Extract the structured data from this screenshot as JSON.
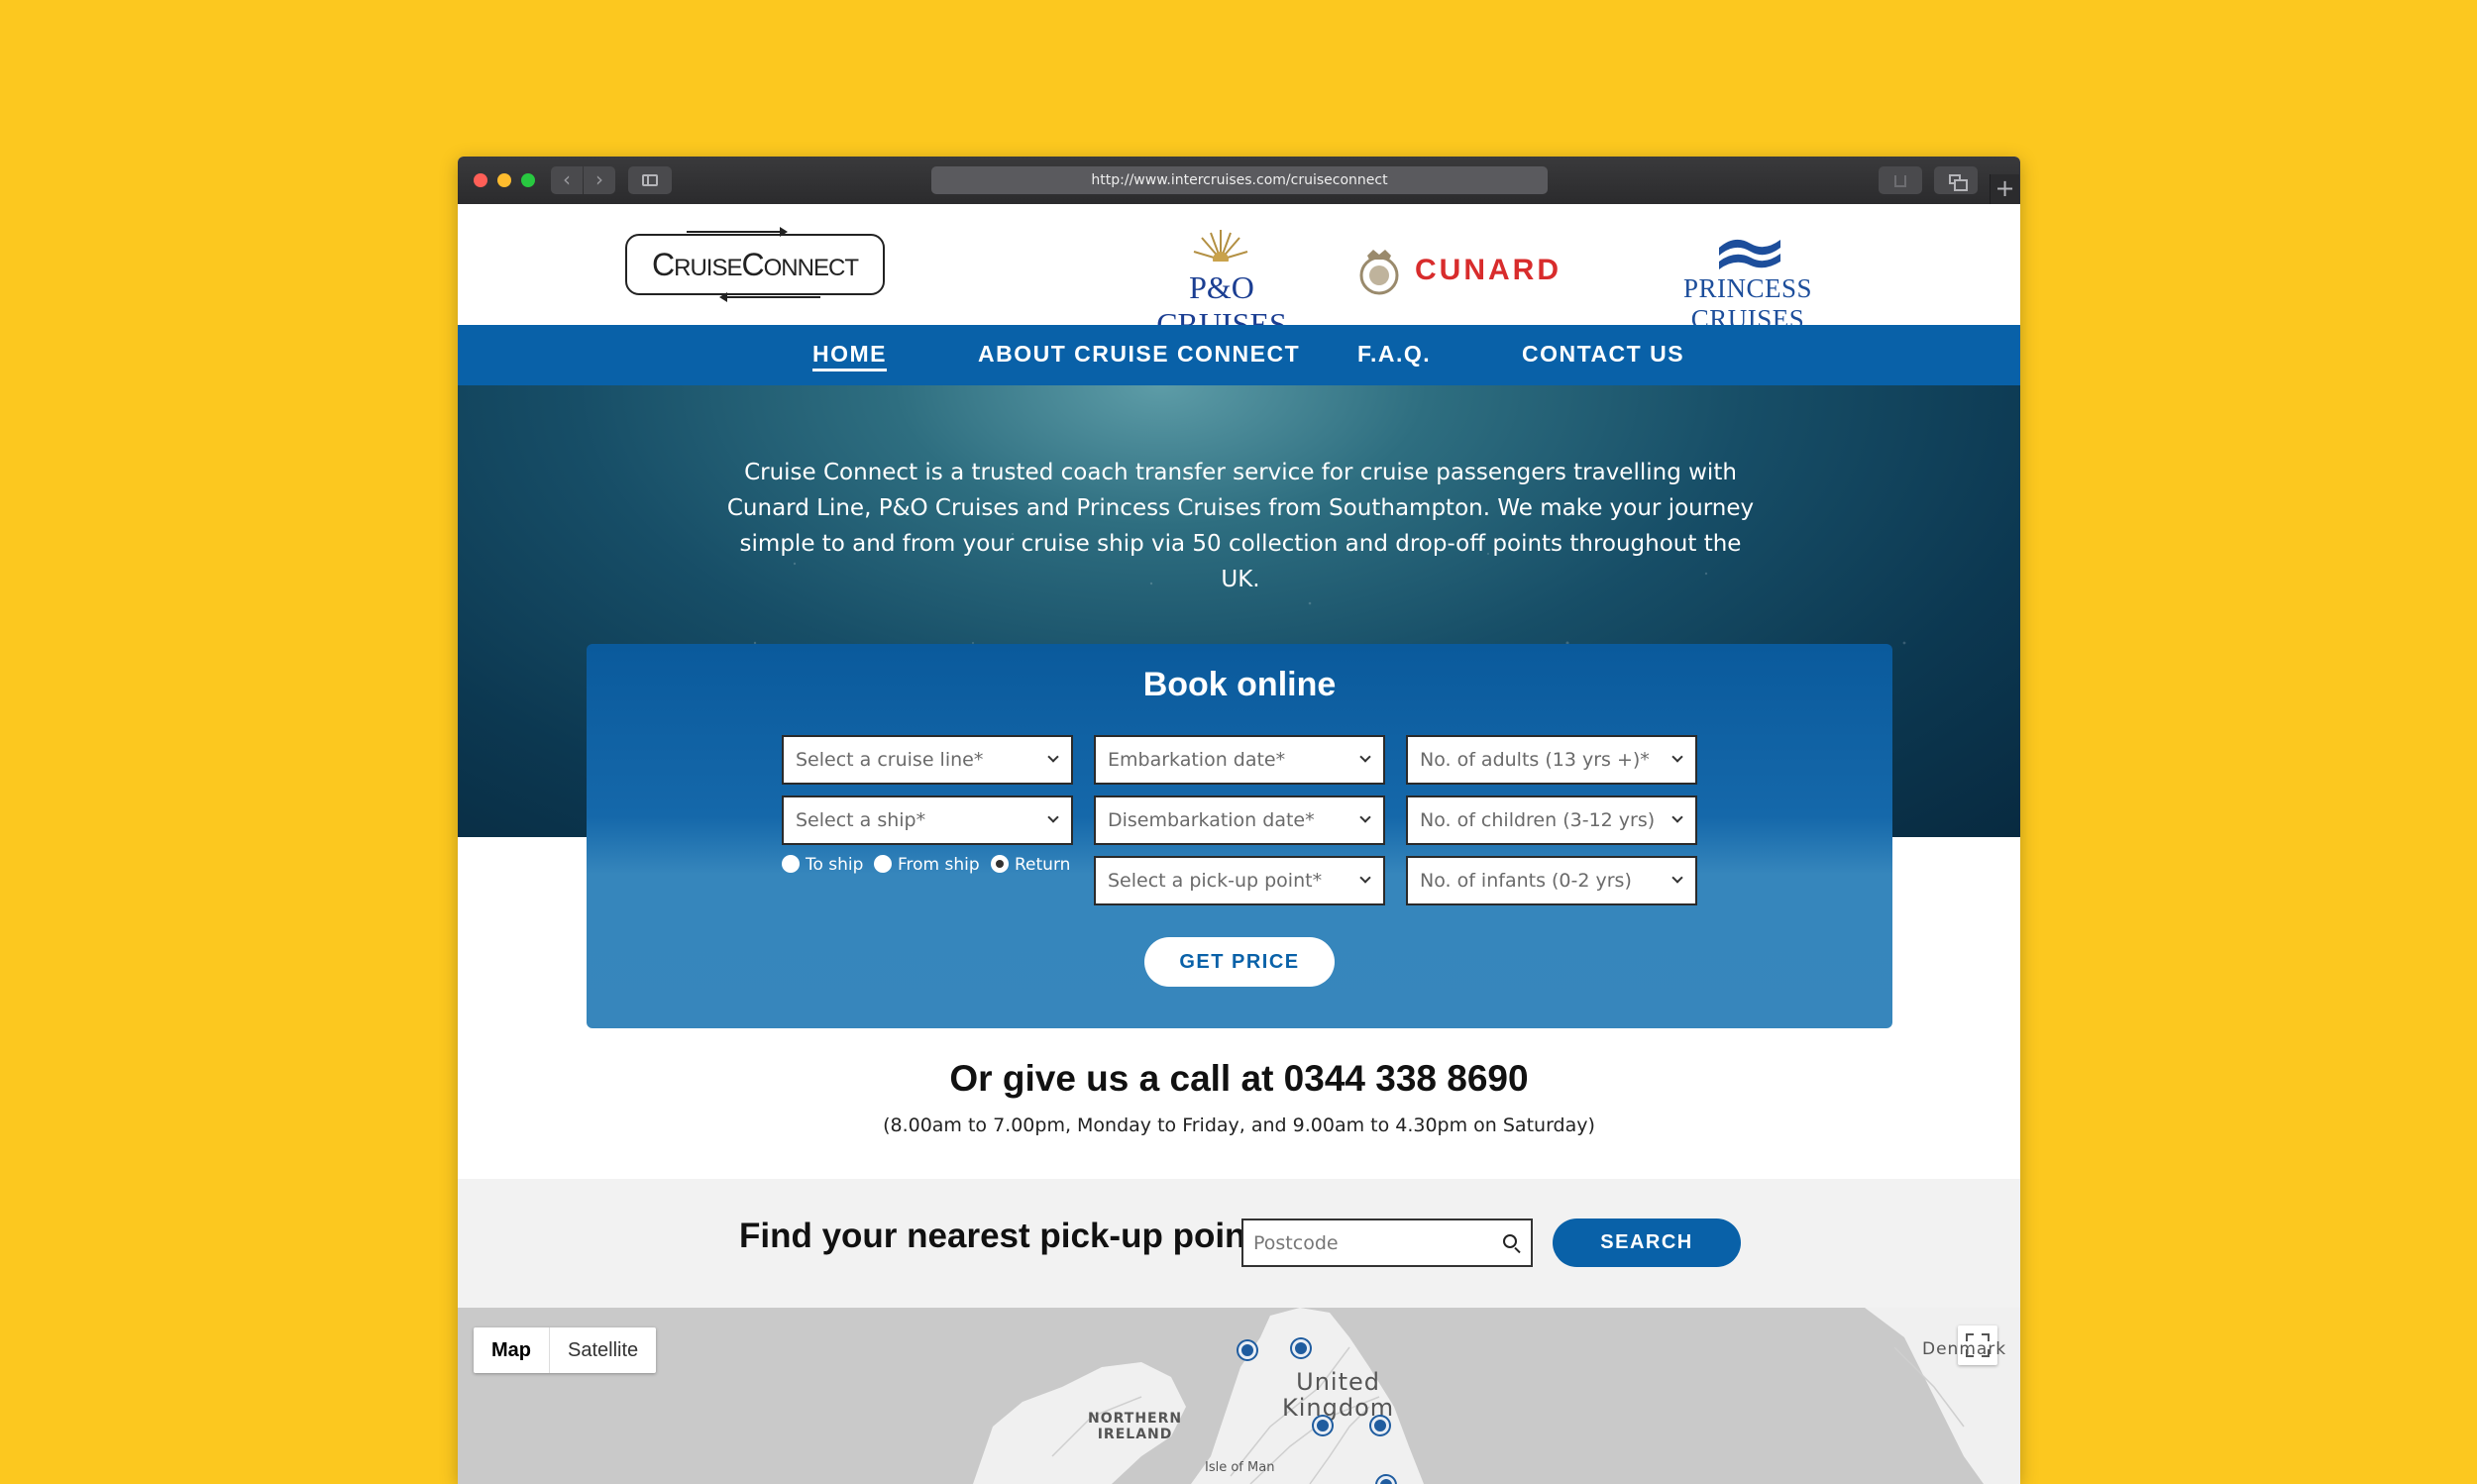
{
  "browser": {
    "url": "http://www.intercruises.com/cruiseconnect"
  },
  "header": {
    "logo_text": "CruiseConnect",
    "partners": {
      "po": "P&O CRUISES",
      "cunard": "CUNARD",
      "princess": "PRINCESS CRUISES"
    }
  },
  "nav": {
    "items": [
      {
        "label": "HOME",
        "active": true
      },
      {
        "label": "ABOUT CRUISE CONNECT"
      },
      {
        "label": "F.A.Q."
      },
      {
        "label": "CONTACT US"
      }
    ]
  },
  "hero": {
    "text": "Cruise Connect is a trusted coach transfer service for cruise passengers travelling with Cunard Line, P&O Cruises and Princess Cruises from Southampton. We make your journey simple to and from your cruise ship via 50 collection and drop-off points throughout the UK."
  },
  "booking": {
    "title": "Book online",
    "fields": {
      "cruise_line": "Select a cruise line*",
      "ship": "Select a ship*",
      "embark": "Embarkation date*",
      "disembark": "Disembarkation date*",
      "pickup": "Select a pick-up point*",
      "adults": "No. of adults (13 yrs +)*",
      "children": "No. of children (3-12 yrs)",
      "infants": "No. of infants (0-2 yrs)"
    },
    "direction": {
      "to_ship": "To ship",
      "from_ship": "From ship",
      "return": "Return",
      "selected": "Return"
    },
    "button": "GET PRICE"
  },
  "call": {
    "title": "Or give us a call at 0344 338 8690",
    "hours": "(8.00am to 7.00pm, Monday to Friday, and 9.00am to 4.30pm on Saturday)"
  },
  "finder": {
    "title": "Find your nearest pick-up point",
    "placeholder": "Postcode",
    "button": "SEARCH"
  },
  "map": {
    "type_map": "Map",
    "type_satellite": "Satellite",
    "selected_type": "Map",
    "labels": {
      "uk": "United\nKingdom",
      "ni": "NORTHERN\nIRELAND",
      "iom": "Isle of Man",
      "denmark": "Denmark"
    },
    "colors": {
      "land": "#F0F0F0",
      "sea": "#C9C9C9",
      "pin": "#1F5C9F"
    }
  },
  "colors": {
    "page_bg": "#FCC81F",
    "brand_blue": "#0961A8"
  }
}
